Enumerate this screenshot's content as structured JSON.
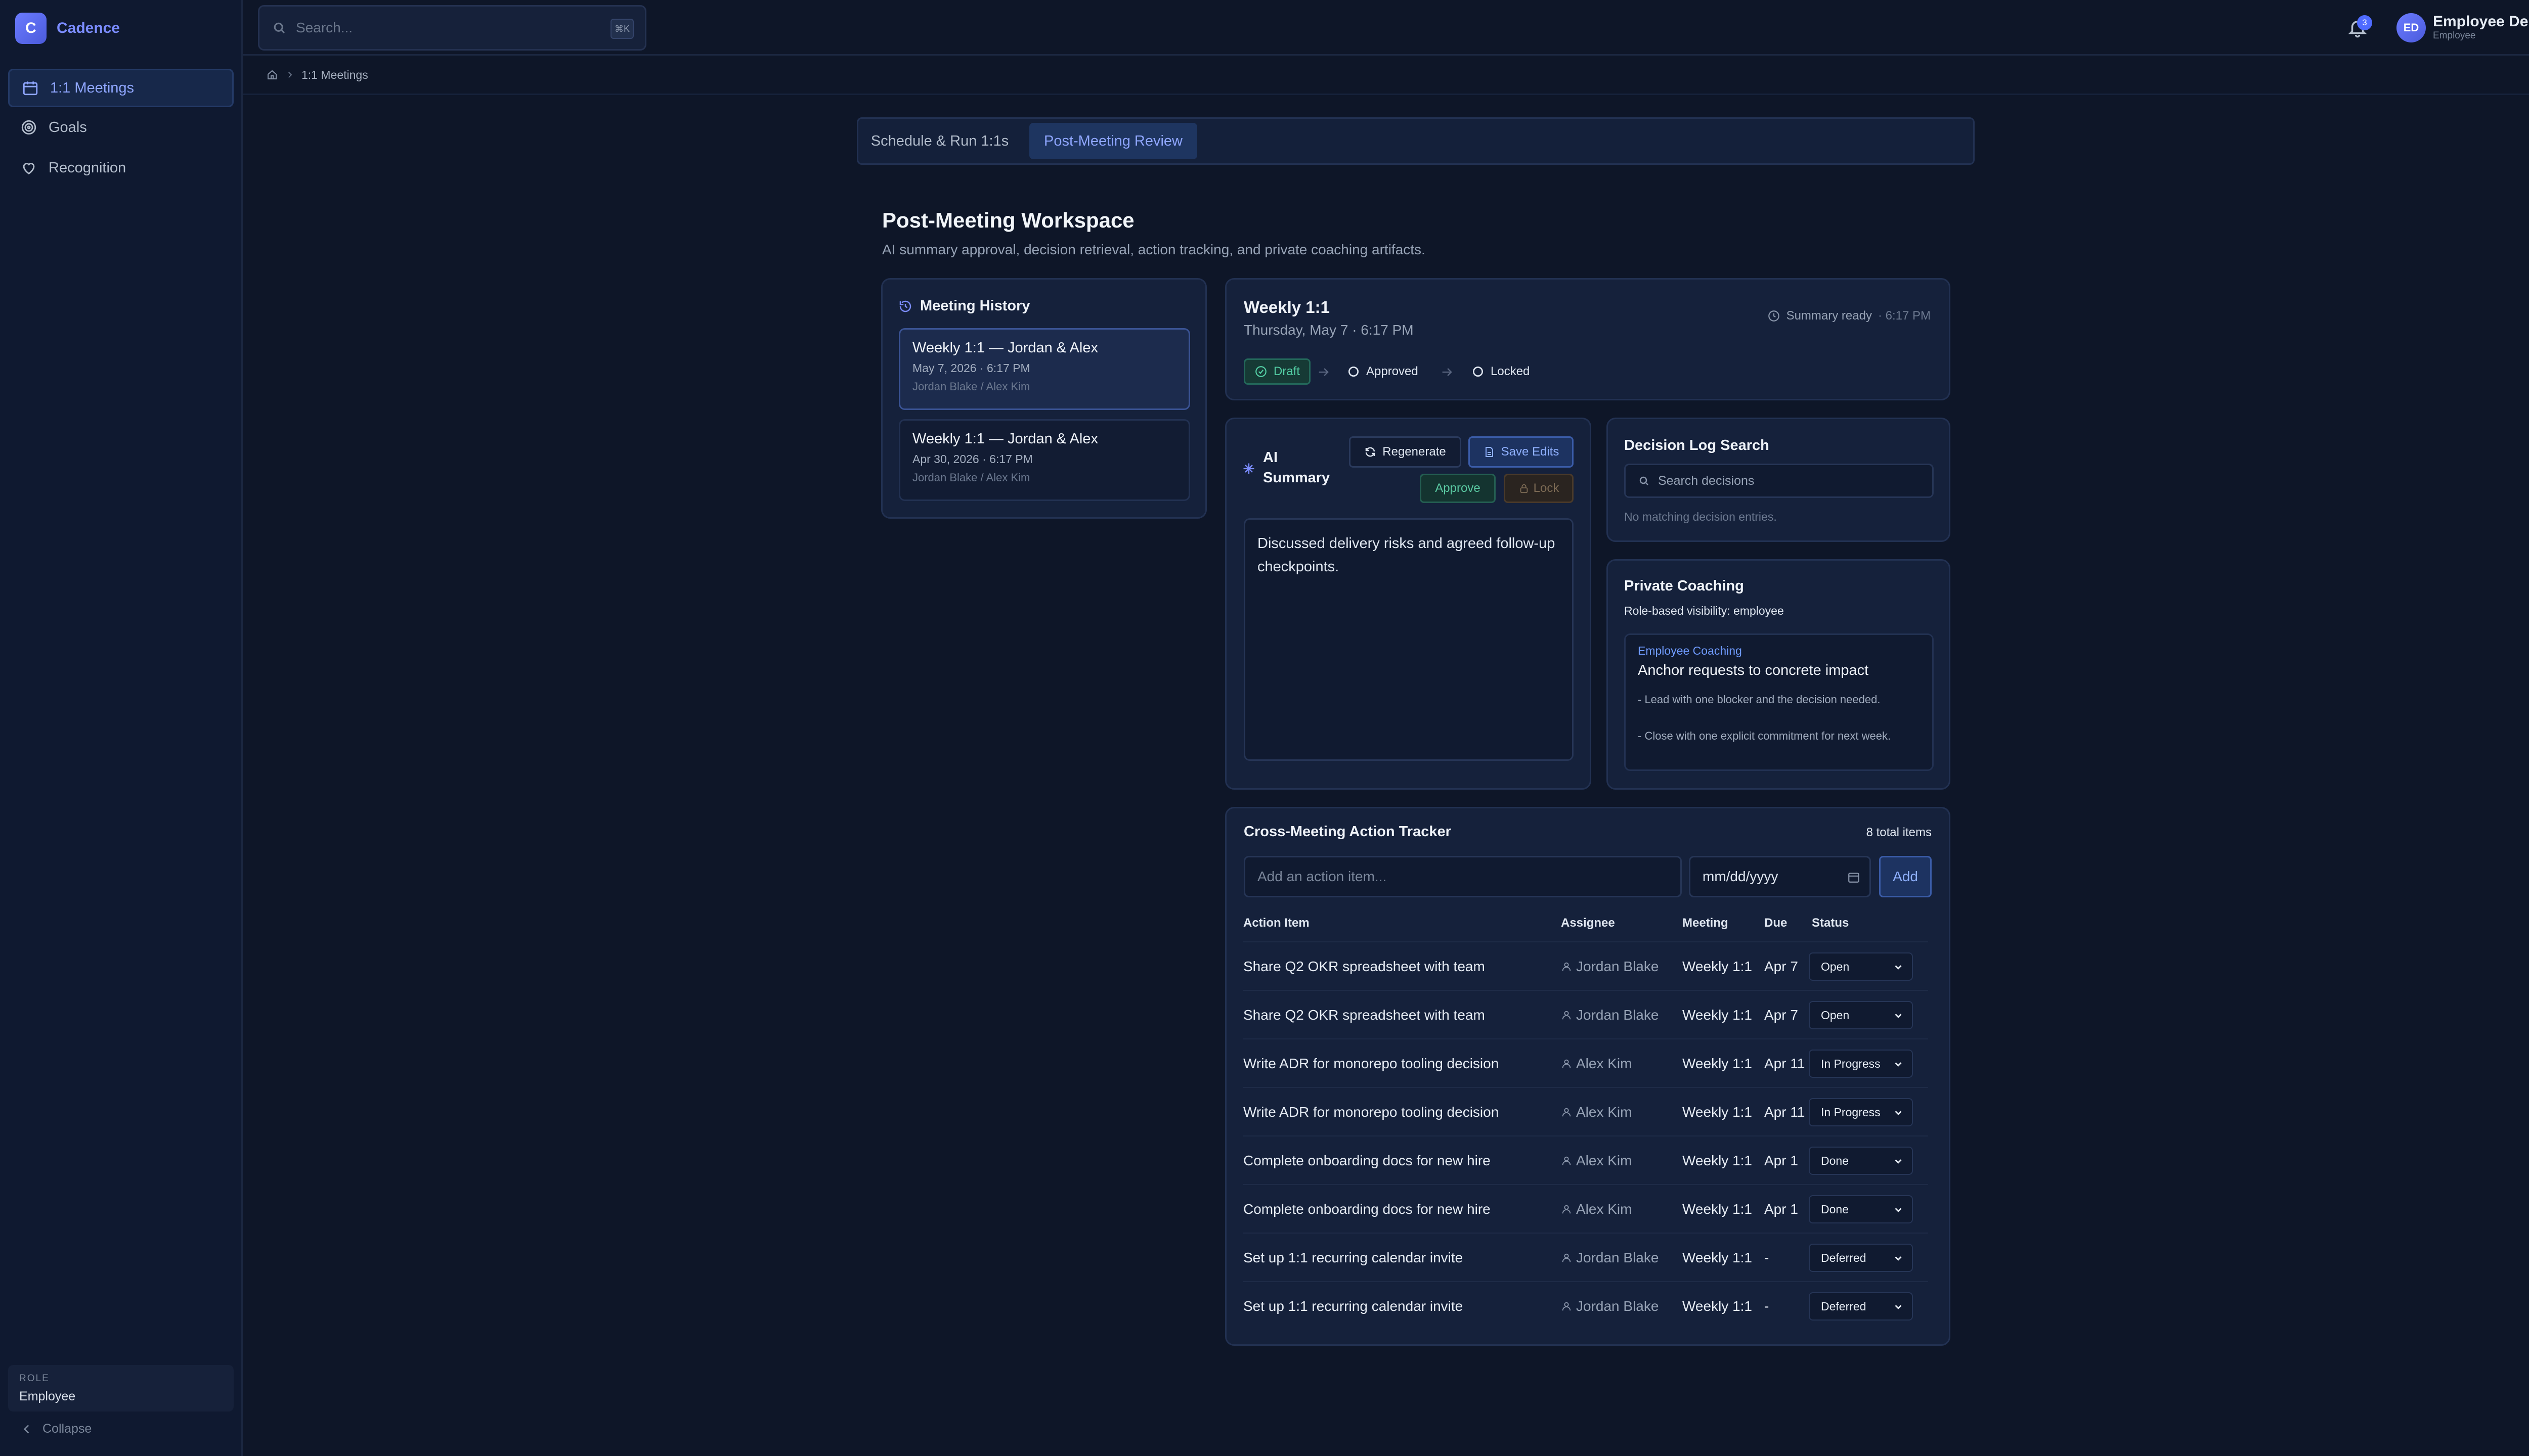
{
  "app": {
    "logo_letter": "C",
    "name": "Cadence"
  },
  "sidebar": {
    "items": [
      {
        "label": "1:1 Meetings",
        "icon": "calendar-icon",
        "active": true
      },
      {
        "label": "Goals",
        "icon": "target-icon",
        "active": false
      },
      {
        "label": "Recognition",
        "icon": "heart-icon",
        "active": false
      }
    ],
    "role_label": "ROLE",
    "role_value": "Employee",
    "collapse_label": "Collapse"
  },
  "header": {
    "search_placeholder": "Search...",
    "search_shortcut": "⌘K",
    "notification_count": "3",
    "user_initials": "ED",
    "user_name": "Employee Demo",
    "user_role": "Employee"
  },
  "breadcrumb": {
    "current": "1:1 Meetings"
  },
  "tabs": [
    {
      "label": "Schedule & Run 1:1s",
      "active": false
    },
    {
      "label": "Post-Meeting Review",
      "active": true
    }
  ],
  "page": {
    "title": "Post-Meeting Workspace",
    "subtitle": "AI summary approval, decision retrieval, action tracking, and private coaching artifacts."
  },
  "history": {
    "title": "Meeting History",
    "items": [
      {
        "title": "Weekly 1:1 — Jordan & Alex",
        "date": "May 7, 2026 · 6:17 PM",
        "people": "Jordan Blake / Alex Kim",
        "active": true
      },
      {
        "title": "Weekly 1:1 — Jordan & Alex",
        "date": "Apr 30, 2026 · 6:17 PM",
        "people": "Jordan Blake / Alex Kim",
        "active": false
      }
    ]
  },
  "meeting": {
    "title": "Weekly 1:1",
    "date": "Thursday, May 7 · 6:17 PM",
    "summary_status": "Summary ready",
    "summary_time": "· 6:17 PM",
    "steps": [
      "Draft",
      "Approved",
      "Locked"
    ]
  },
  "ai_summary": {
    "title_line1": "AI",
    "title_line2": "Summary",
    "regenerate": "Regenerate",
    "save_edits": "Save Edits",
    "approve": "Approve",
    "lock": "Lock",
    "text": "Discussed delivery risks and agreed follow-up checkpoints."
  },
  "decision_log": {
    "title": "Decision Log Search",
    "placeholder": "Search decisions",
    "empty": "No matching decision entries."
  },
  "coaching": {
    "title": "Private Coaching",
    "visibility": "Role-based visibility: employee",
    "card_label": "Employee Coaching",
    "card_title": "Anchor requests to concrete impact",
    "bullet1": "- Lead with one blocker and the decision needed.",
    "bullet2": "- Close with one explicit commitment for next week."
  },
  "tracker": {
    "title": "Cross-Meeting Action Tracker",
    "count": "8 total items",
    "new_item_placeholder": "Add an action item...",
    "date_placeholder": "mm/dd/yyyy",
    "add_label": "Add",
    "columns": [
      "Action Item",
      "Assignee",
      "Meeting",
      "Due",
      "Status"
    ],
    "rows": [
      {
        "item": "Share Q2 OKR spreadsheet with team",
        "assignee": "Jordan Blake",
        "meeting": "Weekly 1:1",
        "due": "Apr 7",
        "status": "Open"
      },
      {
        "item": "Share Q2 OKR spreadsheet with team",
        "assignee": "Jordan Blake",
        "meeting": "Weekly 1:1",
        "due": "Apr 7",
        "status": "Open"
      },
      {
        "item": "Write ADR for monorepo tooling decision",
        "assignee": "Alex Kim",
        "meeting": "Weekly 1:1",
        "due": "Apr 11",
        "status": "In Progress"
      },
      {
        "item": "Write ADR for monorepo tooling decision",
        "assignee": "Alex Kim",
        "meeting": "Weekly 1:1",
        "due": "Apr 11",
        "status": "In Progress"
      },
      {
        "item": "Complete onboarding docs for new hire",
        "assignee": "Alex Kim",
        "meeting": "Weekly 1:1",
        "due": "Apr 1",
        "status": "Done"
      },
      {
        "item": "Complete onboarding docs for new hire",
        "assignee": "Alex Kim",
        "meeting": "Weekly 1:1",
        "due": "Apr 1",
        "status": "Done"
      },
      {
        "item": "Set up 1:1 recurring calendar invite",
        "assignee": "Jordan Blake",
        "meeting": "Weekly 1:1",
        "due": "-",
        "status": "Deferred"
      },
      {
        "item": "Set up 1:1 recurring calendar invite",
        "assignee": "Jordan Blake",
        "meeting": "Weekly 1:1",
        "due": "-",
        "status": "Deferred"
      }
    ]
  },
  "colors": {
    "background": "#0e1628",
    "accent": "#7b8cff",
    "success": "#54d0a6"
  }
}
